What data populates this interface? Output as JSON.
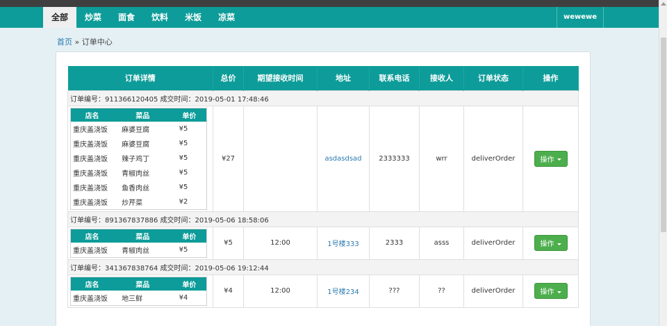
{
  "nav": {
    "tabs": [
      "全部",
      "炒菜",
      "面食",
      "饮料",
      "米饭",
      "凉菜"
    ],
    "active_index": 0,
    "user": "wewewe"
  },
  "breadcrumb": {
    "home": "首页",
    "separator": "»",
    "current": "订单中心"
  },
  "table": {
    "headers": [
      "订单详情",
      "总价",
      "期望接收时间",
      "地址",
      "联系电话",
      "接收人",
      "订单状态",
      "操作"
    ],
    "item_headers": [
      "店名",
      "菜品",
      "单价"
    ]
  },
  "orders": [
    {
      "meta": "订单编号：911366120405 成交时间：2019-05-01 17:48:46",
      "items": [
        {
          "shop": "重庆盖浇饭",
          "dish": "麻婆豆腐",
          "price": "¥5"
        },
        {
          "shop": "重庆盖浇饭",
          "dish": "麻婆豆腐",
          "price": "¥5"
        },
        {
          "shop": "重庆盖浇饭",
          "dish": "辣子鸡丁",
          "price": "¥5"
        },
        {
          "shop": "重庆盖浇饭",
          "dish": "青椒肉丝",
          "price": "¥5"
        },
        {
          "shop": "重庆盖浇饭",
          "dish": "鱼香肉丝",
          "price": "¥5"
        },
        {
          "shop": "重庆盖浇饭",
          "dish": "炒芹菜",
          "price": "¥2"
        }
      ],
      "total": "¥27",
      "time": "",
      "address": "asdasdsad",
      "phone": "2333333",
      "receiver": "wrr",
      "status": "deliverOrder",
      "action": "操作"
    },
    {
      "meta": "订单编号：891367837886 成交时间：2019-05-06 18:58:06",
      "items": [
        {
          "shop": "重庆盖浇饭",
          "dish": "青椒肉丝",
          "price": "¥5"
        }
      ],
      "total": "¥5",
      "time": "12:00",
      "address": "1号楼333",
      "phone": "2333",
      "receiver": "asss",
      "status": "deliverOrder",
      "action": "操作"
    },
    {
      "meta": "订单编号：341367838764 成交时间：2019-05-06 19:12:44",
      "items": [
        {
          "shop": "重庆盖浇饭",
          "dish": "地三鲜",
          "price": "¥4"
        }
      ],
      "total": "¥4",
      "time": "12:00",
      "address": "1号楼234",
      "phone": "???",
      "receiver": "??",
      "status": "deliverOrder",
      "action": "操作"
    }
  ],
  "colors": {
    "teal": "#0d9c99",
    "button_green": "#4cae4c",
    "link": "#2a7ab0"
  }
}
